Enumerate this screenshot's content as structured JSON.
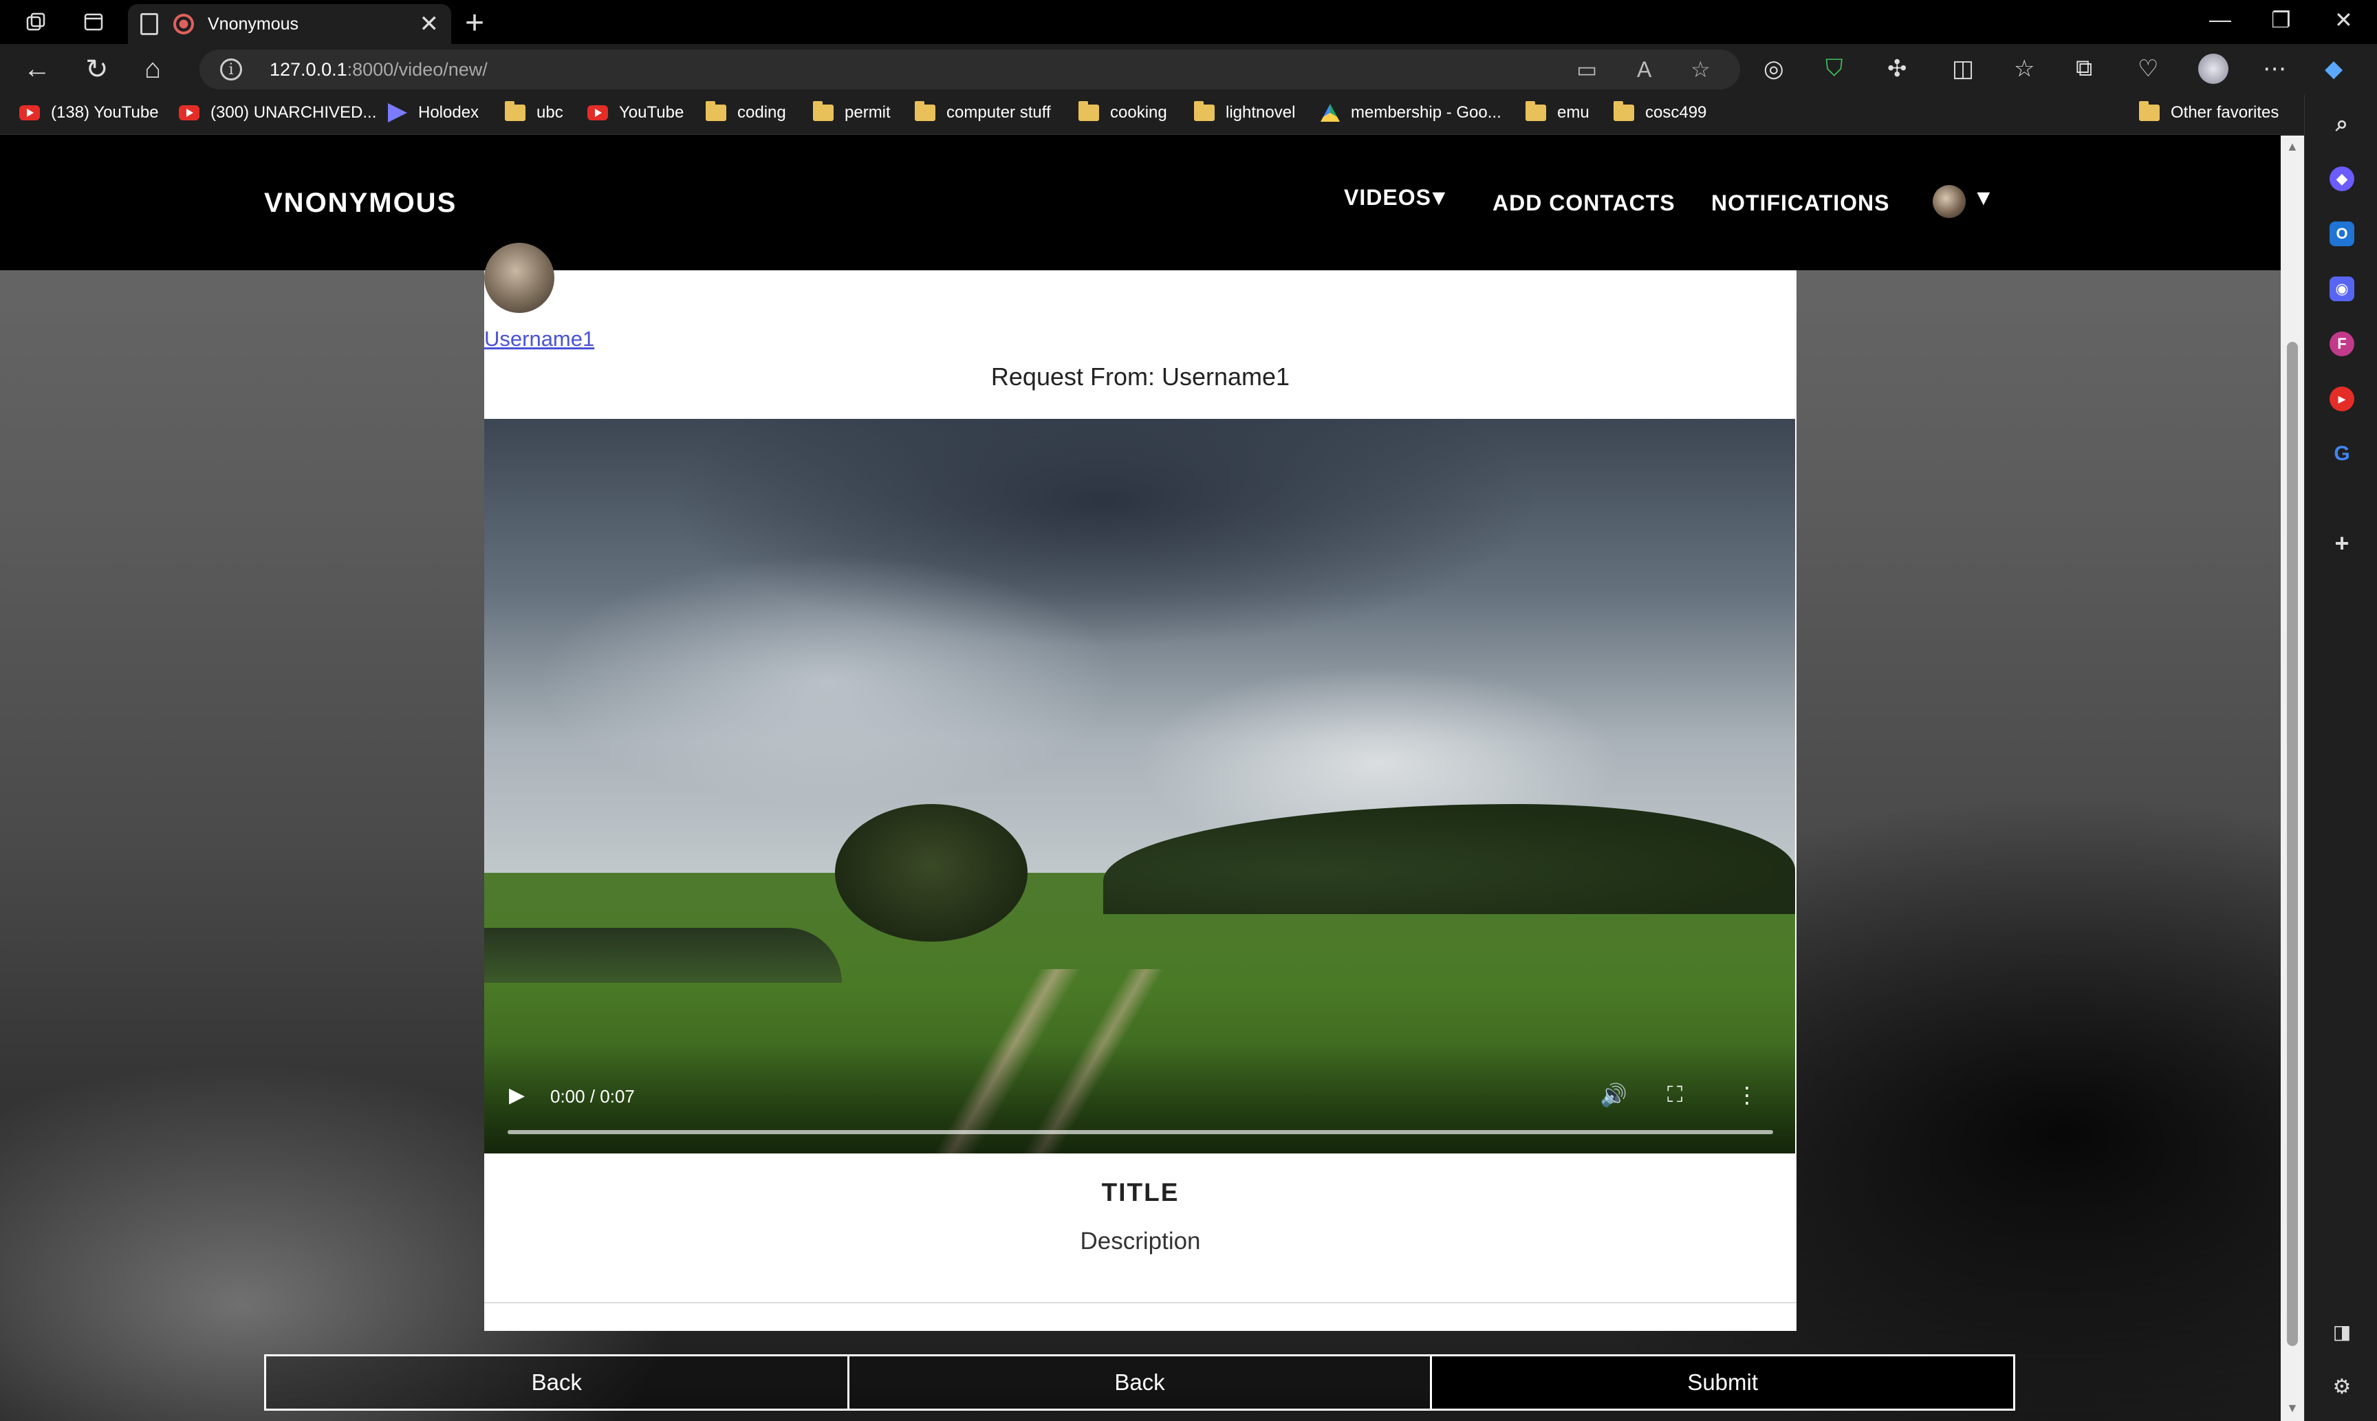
{
  "browser": {
    "tab_title": "Vnonymous",
    "url_host": "127.0.0.1",
    "url_rest": ":8000/video/new/",
    "bookmarks": [
      {
        "label": "(138) YouTube",
        "icon": "youtube-icon"
      },
      {
        "label": "(300) UNARCHIVED...",
        "icon": "youtube-icon"
      },
      {
        "label": "Holodex",
        "icon": "holodex-icon"
      },
      {
        "label": "ubc",
        "icon": "folder-icon"
      },
      {
        "label": "YouTube",
        "icon": "youtube-icon"
      },
      {
        "label": "coding",
        "icon": "folder-icon"
      },
      {
        "label": "permit",
        "icon": "folder-icon"
      },
      {
        "label": "computer stuff",
        "icon": "folder-icon"
      },
      {
        "label": "cooking",
        "icon": "folder-icon"
      },
      {
        "label": "lightnovel",
        "icon": "folder-icon"
      },
      {
        "label": "membership - Goo...",
        "icon": "google-drive-icon"
      },
      {
        "label": "emu",
        "icon": "folder-icon"
      },
      {
        "label": "cosc499",
        "icon": "folder-icon"
      }
    ],
    "other_favorites": "Other favorites"
  },
  "site": {
    "brand": "VNONYMOUS",
    "nav": {
      "videos": "VIDEOS",
      "add_contacts": "ADD CONTACTS",
      "notifications": "NOTIFICATIONS"
    },
    "caret": "▼"
  },
  "card": {
    "username": "Username1",
    "request": "Request From: Username1",
    "video": {
      "time": "0:00 / 0:07",
      "progress": 0.0
    },
    "title": "TITLE",
    "description": "Description"
  },
  "buttons": {
    "back_1": "Back",
    "back_2": "Back",
    "submit": "Submit"
  },
  "colors": {
    "link": "#4a52d8",
    "header_bg": "#000000",
    "card_bg": "#ffffff"
  }
}
